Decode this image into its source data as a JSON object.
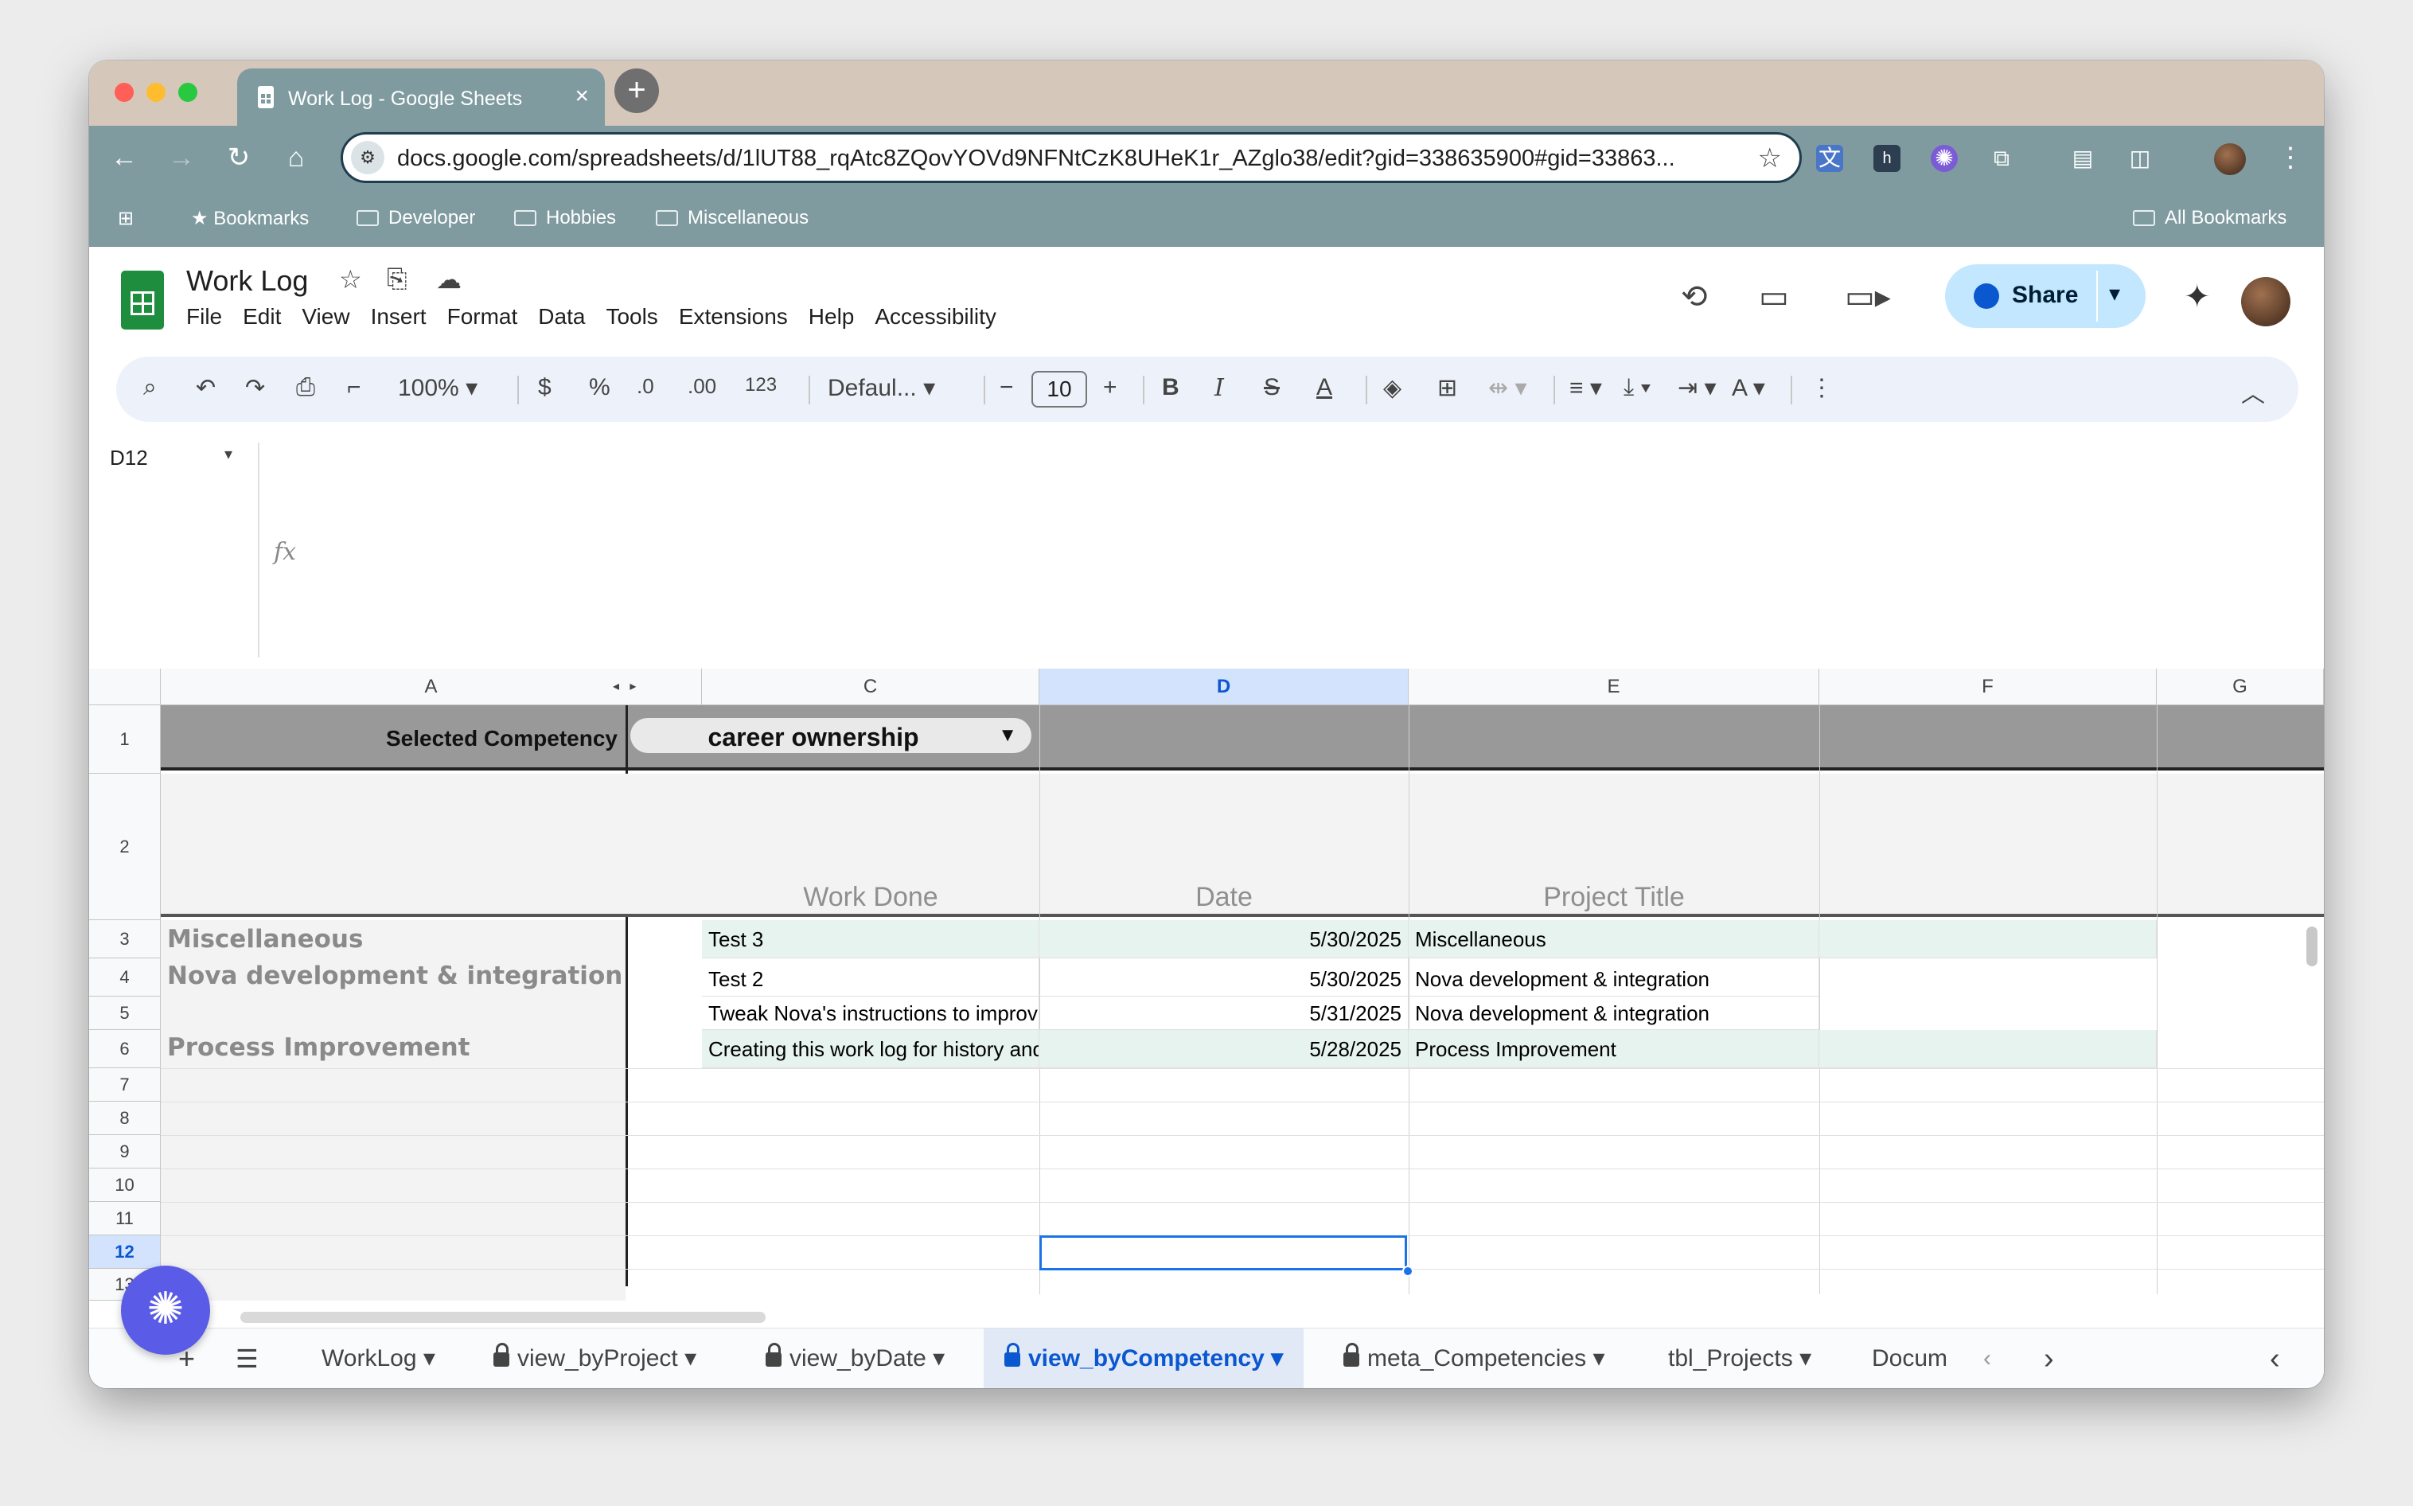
{
  "browser": {
    "tab_title": "Work Log - Google Sheets",
    "url": "docs.google.com/spreadsheets/d/1lUT88_rqAtc8ZQovYOVd9NFNtCzK8UHeK1r_AZglo38/edit?gid=338635900#gid=33863...",
    "bookmarks": [
      "Bookmarks",
      "Developer",
      "Hobbies",
      "Miscellaneous"
    ],
    "all_bookmarks": "All Bookmarks"
  },
  "sheets": {
    "doc_title": "Work Log",
    "menu": [
      "File",
      "Edit",
      "View",
      "Insert",
      "Format",
      "Data",
      "Tools",
      "Extensions",
      "Help",
      "Accessibility"
    ],
    "share_label": "Share",
    "toolbar": {
      "zoom": "100%",
      "currency": "$",
      "percent": "%",
      "dec_decrease": ".0",
      "dec_increase": ".00",
      "number_format": "123",
      "font": "Defaul...",
      "font_size": "10",
      "bold": "B",
      "italic": "I"
    },
    "name_box": "D12",
    "fx": "fx"
  },
  "grid": {
    "columns": [
      "A",
      "C",
      "D",
      "E",
      "F",
      "G"
    ],
    "row_numbers": [
      "1",
      "2",
      "3",
      "4",
      "5",
      "6",
      "7",
      "8",
      "9",
      "10",
      "11",
      "12",
      "13"
    ],
    "selected_competency_label": "Selected Competency",
    "selected_competency_value": "career ownership",
    "headers": {
      "work_done": "Work Done",
      "date": "Date",
      "project_title": "Project Title"
    },
    "groups": {
      "miscellaneous": "Miscellaneous",
      "nova": "Nova development & integration",
      "process": "Process Improvement"
    },
    "rows": [
      {
        "work": "Test 3",
        "date": "5/30/2025",
        "project": "Miscellaneous"
      },
      {
        "work": "Test 2",
        "date": "5/30/2025",
        "project": "Nova development & integration"
      },
      {
        "work": "Tweak Nova's instructions to improve data fe",
        "date": "5/31/2025",
        "project": "Nova development & integration"
      },
      {
        "work": "Creating this work log for history and visibility",
        "date": "5/28/2025",
        "project": "Process Improvement"
      }
    ]
  },
  "sheet_tabs": {
    "tabs": [
      "WorkLog",
      "view_byProject",
      "view_byDate",
      "view_byCompetency",
      "meta_Competencies",
      "tbl_Projects",
      "Docum"
    ],
    "active": "view_byCompetency"
  },
  "colors": {
    "chrome_accent": "#7f9ba0",
    "header_band": "#999999",
    "row_highlight": "#e7f3ef",
    "selection_blue": "#1a73e8",
    "fab": "#5a5be6"
  }
}
